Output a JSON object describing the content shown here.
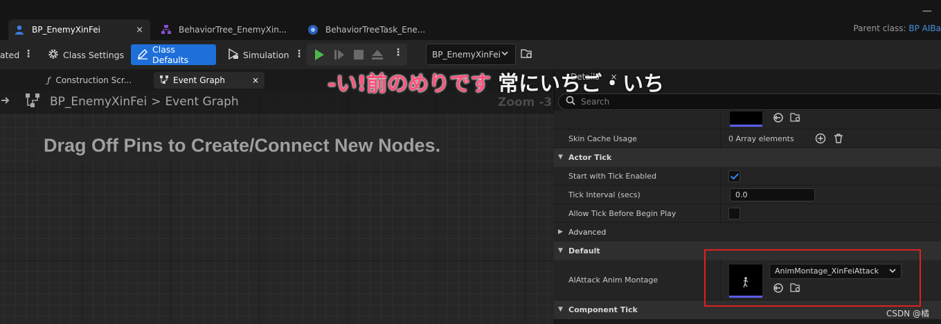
{
  "window": {
    "minimize_glyph": "—"
  },
  "tabs": [
    {
      "label": "BP_EnemyXinFei",
      "icon": "blueprint-person-icon",
      "active": true,
      "close": "×"
    },
    {
      "label": "BehaviorTree_EnemyXin...",
      "icon": "behavior-tree-icon",
      "active": false
    },
    {
      "label": "BehaviorTreeTask_Ene...",
      "icon": "behavior-task-icon",
      "active": false
    }
  ],
  "parent_class": {
    "label": "Parent class:",
    "value": "BP AIBa"
  },
  "toolbar": {
    "partial_left": "ated",
    "class_settings": "Class Settings",
    "class_defaults": "Class Defaults",
    "simulation": "Simulation",
    "debug_object": "BP_EnemyXinFei"
  },
  "graph_tabs": [
    {
      "label": "Construction Scr...",
      "icon": "function-icon"
    },
    {
      "label": "Event Graph",
      "icon": "event-graph-icon",
      "active": true,
      "close": "×"
    }
  ],
  "breadcrumb": {
    "root": "BP_EnemyXinFei",
    "separator": ">",
    "current": "Event Graph"
  },
  "zoom": "Zoom -3",
  "graph_hint": "Drag Off Pins to Create/Connect New Nodes.",
  "caption": {
    "pink": "-い!前のめりです",
    "white": "常にいちご・いち"
  },
  "details": {
    "tab_label": "Details",
    "search_placeholder": "Search",
    "skin_cache_label": "Skin Cache Usage",
    "skin_cache_value": "0 Array elements",
    "actor_tick_category": "Actor Tick",
    "start_tick_label": "Start with Tick Enabled",
    "start_tick_checked": true,
    "tick_interval_label": "Tick Interval (secs)",
    "tick_interval_value": "0.0",
    "allow_tick_label": "Allow Tick Before Begin Play",
    "allow_tick_checked": false,
    "advanced_category": "Advanced",
    "default_category": "Default",
    "montage_label": "AIAttack Anim Montage",
    "montage_value": "AnimMontage_XinFeiAttack",
    "component_tick_category": "Component Tick"
  },
  "colors": {
    "accent": "#1e6fd9",
    "highlight_box": "#e02020",
    "caption_pink": "#ff4f7a"
  },
  "watermark": "CSDN @橘"
}
